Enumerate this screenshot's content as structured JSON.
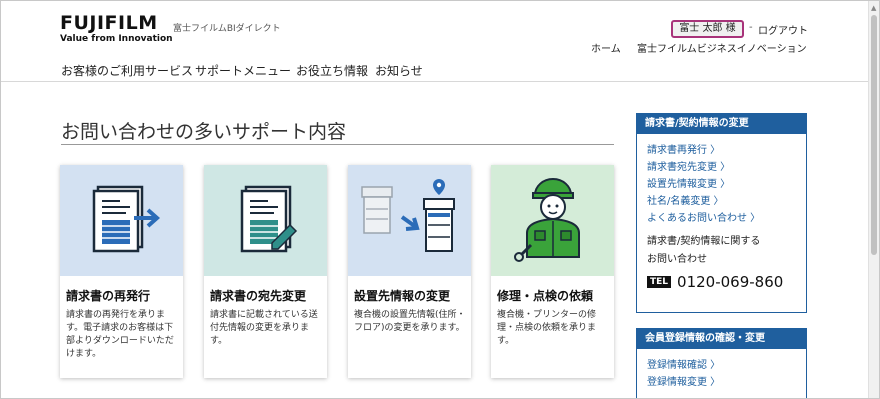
{
  "header": {
    "logo_mark": "FUJIFILM",
    "logo_tagline": "Value from Innovation",
    "site_name": "富士フイルムBIダイレクト",
    "user_name": "富士 太郎 様",
    "separator": "-",
    "logout_label": "ログアウト",
    "home_label": "ホーム",
    "bi_label": "富士フイルムビジネスイノベーション"
  },
  "global_nav": [
    {
      "label": "お客様のご利用サービス"
    },
    {
      "label": "サポートメニュー"
    },
    {
      "label": "お役立ち情報"
    },
    {
      "label": "お知らせ"
    }
  ],
  "main": {
    "title": "お問い合わせの多いサポート内容",
    "cards": [
      {
        "title": "請求書の再発行",
        "desc": "請求書の再発行を承ります。電子請求のお客様は下部よりダウンロードいただけます。",
        "bg": "#d3e1f2",
        "icon": "invoice-reissue-icon"
      },
      {
        "title": "請求書の宛先変更",
        "desc": "請求書に記載されている送付先情報の変更を承ります。",
        "bg": "#cfe7e4",
        "icon": "invoice-edit-icon"
      },
      {
        "title": "設置先情報の変更",
        "desc": "複合機の設置先情報(住所・フロア)の変更を承ります。",
        "bg": "#d3e1f2",
        "icon": "printer-relocation-icon"
      },
      {
        "title": "修理・点検の依頼",
        "desc": "複合機・プリンターの修理・点検の依頼を承ります。",
        "bg": "#d4ecd8",
        "icon": "repair-technician-icon"
      }
    ]
  },
  "sidebar": {
    "contract_box": {
      "title": "請求書/契約情報の変更",
      "links": [
        "請求書再発行 〉",
        "請求書宛先変更 〉",
        "設置先情報変更 〉",
        "社名/名義変更 〉",
        "よくあるお問い合わせ 〉"
      ],
      "contact_line1": "請求書/契約情報に関する",
      "contact_line2": "お問い合わせ",
      "tel_badge": "TEL",
      "tel_number": "0120-069-860"
    },
    "member_box": {
      "title": "会員登録情報の確認・変更",
      "links": [
        "登録情報確認 〉",
        "登録情報変更 〉"
      ]
    }
  },
  "colors": {
    "accent_blue": "#1f5f9e",
    "user_highlight": "#a8337a",
    "arrow_blue": "#2b6cb8",
    "tech_green": "#3aa33a"
  }
}
